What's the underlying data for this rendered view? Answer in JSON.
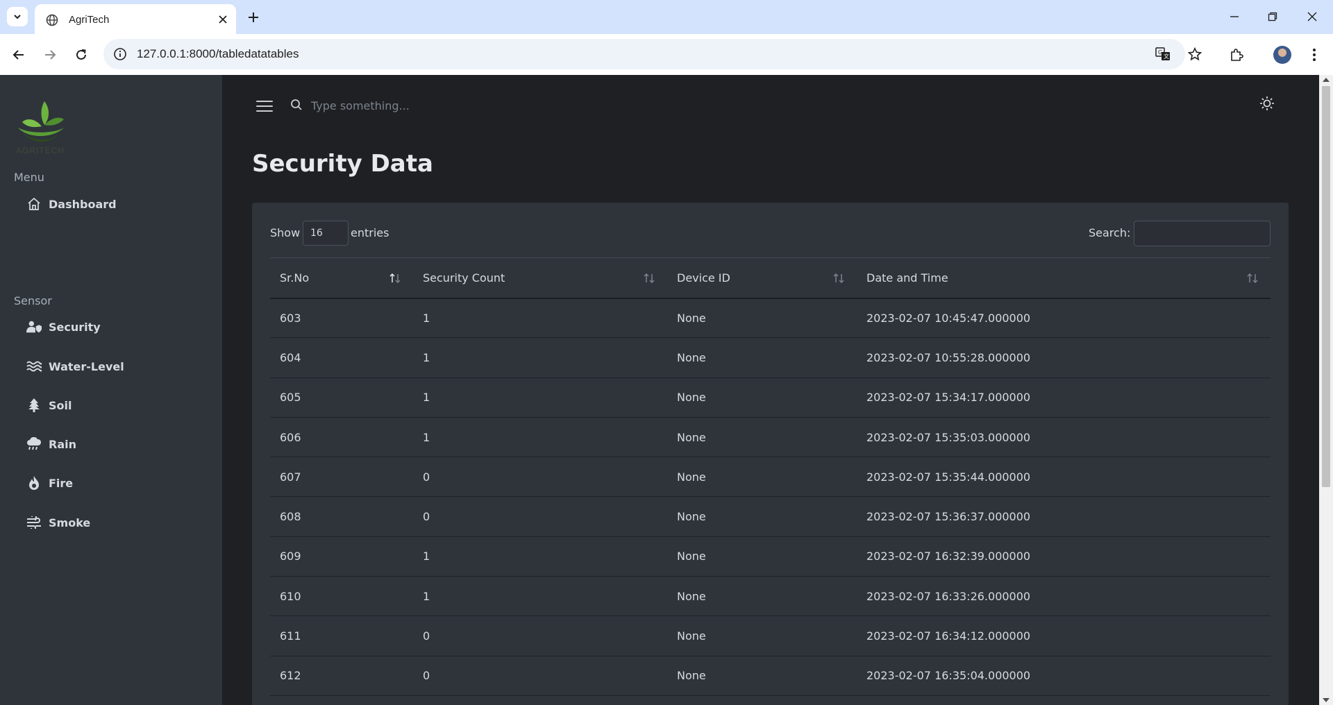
{
  "browser": {
    "tab_title": "AgriTech",
    "url": "127.0.0.1:8000/tabledatatables"
  },
  "sidebar": {
    "logo_text": "AGRITECH",
    "menu_title": "Menu",
    "menu_items": [
      {
        "label": "Dashboard",
        "icon": "home-icon"
      }
    ],
    "sensor_title": "Sensor",
    "sensor_items": [
      {
        "label": "Security",
        "icon": "user-shield-icon"
      },
      {
        "label": "Water-Level",
        "icon": "water-icon"
      },
      {
        "label": "Soil",
        "icon": "tree-icon"
      },
      {
        "label": "Rain",
        "icon": "cloud-rain-icon"
      },
      {
        "label": "Fire",
        "icon": "fire-icon"
      },
      {
        "label": "Smoke",
        "icon": "smog-icon"
      }
    ]
  },
  "topbar": {
    "search_placeholder": "Type something..."
  },
  "page": {
    "title": "Security Data"
  },
  "table_controls": {
    "show_label": "Show",
    "entries_value": "16",
    "entries_label": "entries",
    "search_label": "Search:",
    "search_value": ""
  },
  "table": {
    "columns": [
      "Sr.No",
      "Security Count",
      "Device ID",
      "Date and Time"
    ],
    "rows": [
      [
        "603",
        "1",
        "None",
        "2023-02-07 10:45:47.000000"
      ],
      [
        "604",
        "1",
        "None",
        "2023-02-07 10:55:28.000000"
      ],
      [
        "605",
        "1",
        "None",
        "2023-02-07 15:34:17.000000"
      ],
      [
        "606",
        "1",
        "None",
        "2023-02-07 15:35:03.000000"
      ],
      [
        "607",
        "0",
        "None",
        "2023-02-07 15:35:44.000000"
      ],
      [
        "608",
        "0",
        "None",
        "2023-02-07 15:36:37.000000"
      ],
      [
        "609",
        "1",
        "None",
        "2023-02-07 16:32:39.000000"
      ],
      [
        "610",
        "1",
        "None",
        "2023-02-07 16:33:26.000000"
      ],
      [
        "611",
        "0",
        "None",
        "2023-02-07 16:34:12.000000"
      ],
      [
        "612",
        "0",
        "None",
        "2023-02-07 16:35:04.000000"
      ]
    ]
  },
  "colors": {
    "sidebar_bg": "#2f343b",
    "main_bg": "#1e2024",
    "card_bg": "#2f343b",
    "logo_green": "#6db33f"
  }
}
